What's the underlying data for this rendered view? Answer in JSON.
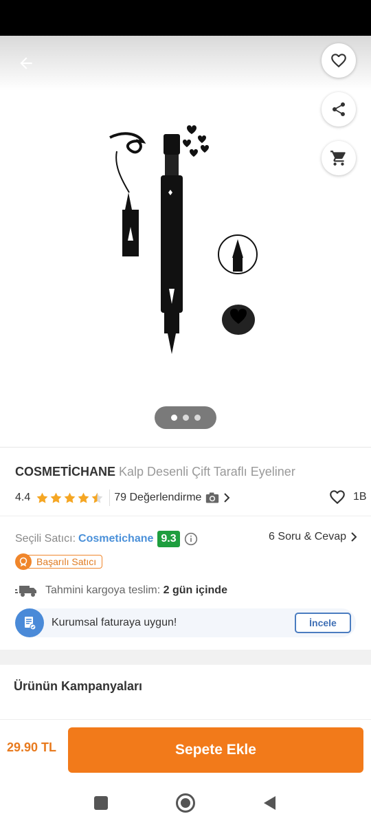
{
  "product": {
    "brand": "COSMETİCHANE",
    "name": "Kalp Desenli Çift Taraflı Eyeliner",
    "rating": 4.4,
    "rating_text": "4.4",
    "review_text": "79 Değerlendirme",
    "favorite_count": "1B",
    "image_count": 3,
    "active_image": 0
  },
  "seller": {
    "label": "Seçili Satıcı:",
    "name": "Cosmetichane",
    "score": "9.3",
    "badge": "Başarılı Satıcı",
    "qa_link": "6 Soru & Cevap"
  },
  "shipping": {
    "label": "Tahmini kargoya teslim:",
    "value": "2 gün içinde"
  },
  "invoice": {
    "text": "Kurumsal faturaya uygun!",
    "button": "İncele"
  },
  "campaigns": {
    "title": "Ürünün Kampanyaları"
  },
  "checkout": {
    "price": "29.90 TL",
    "button": "Sepete Ekle"
  },
  "icons": {
    "back": "arrow-back-icon",
    "favorite": "heart-outline-icon",
    "share": "share-icon",
    "cart": "cart-icon",
    "camera": "camera-icon",
    "info": "info-icon",
    "truck": "truck-icon",
    "invoice": "invoice-icon",
    "badge": "medal-icon"
  },
  "colors": {
    "accent": "#f27a1a",
    "price": "#e87a1e",
    "star": "#f5a623",
    "seller_link": "#4a90d9",
    "seller_score_bg": "#1e9e3e"
  }
}
